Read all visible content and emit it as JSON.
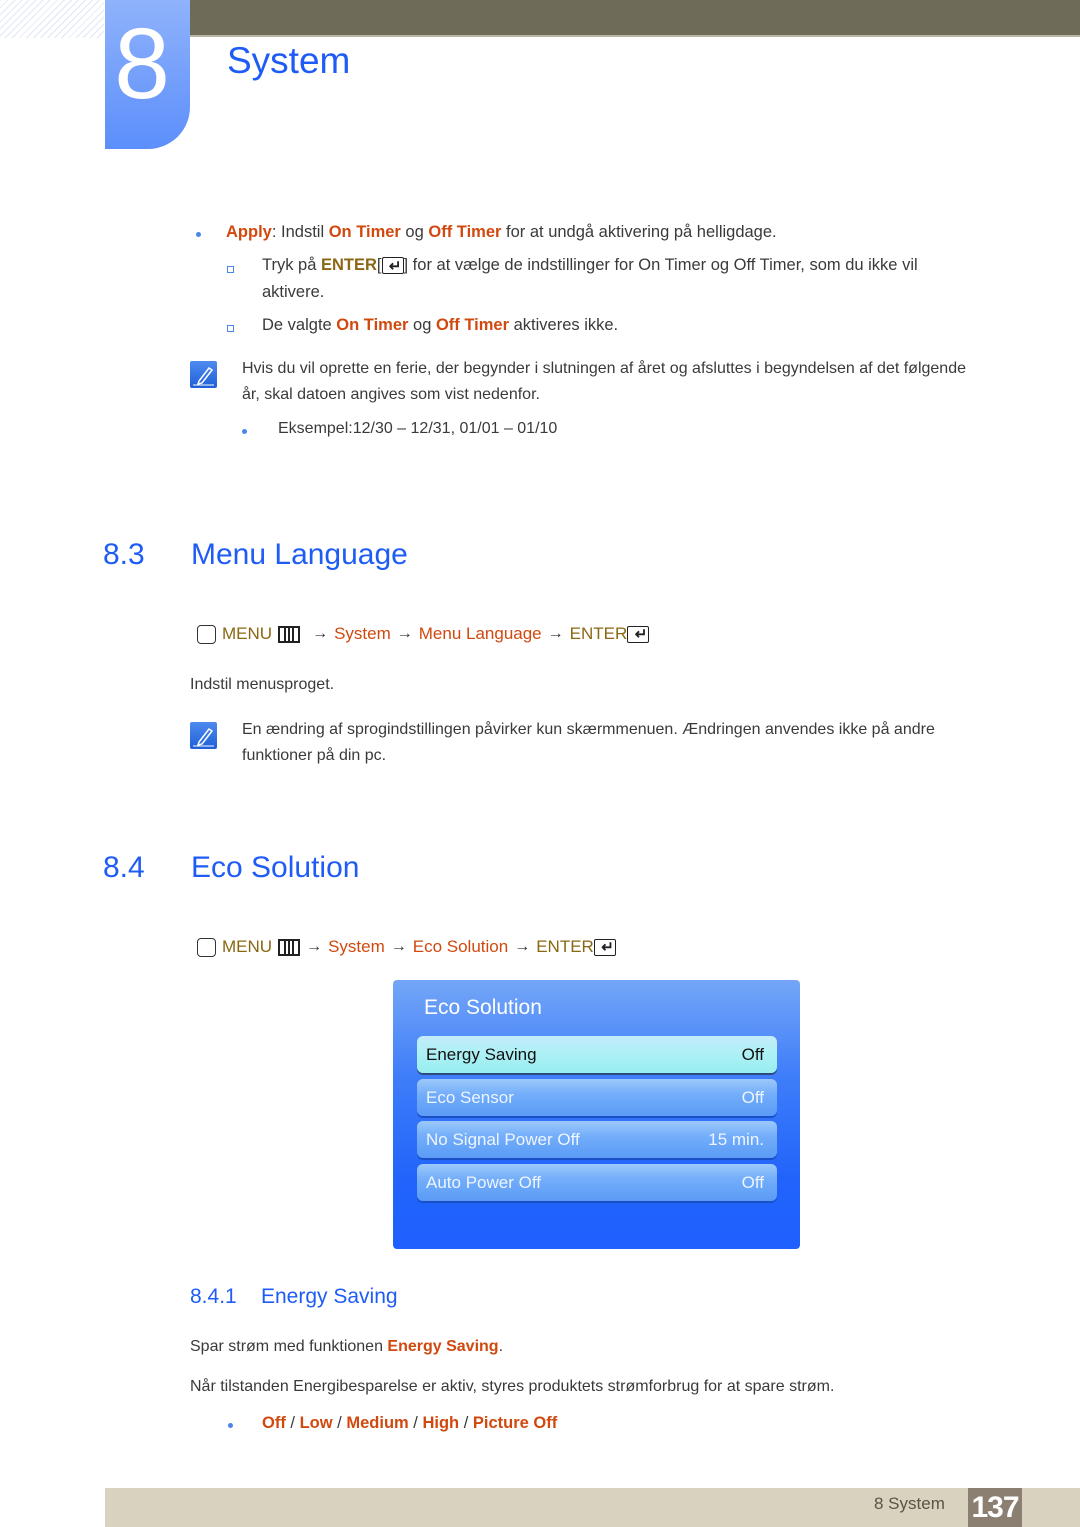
{
  "header": {
    "chapter_number": "8",
    "chapter_title": "System"
  },
  "apply_block": {
    "term": "Apply",
    "text_1": ": Indstil ",
    "on_timer": "On Timer",
    "og": " og ",
    "off_timer": "Off Timer",
    "text_2": " for at undgå aktivering på helligdage.",
    "sub_1_pre": "Tryk på ",
    "sub_1_enter": "ENTER",
    "sub_1_bracket_open": "[",
    "sub_1_bracket_close": "]",
    "sub_1_post": " for at vælge de indstillinger for On Timer og Off Timer, som du ikke vil",
    "sub_1_line2": "aktivere.",
    "sub_2_pre": "De valgte ",
    "sub_2_on": "On Timer",
    "sub_2_og": " og ",
    "sub_2_off": "Off Timer",
    "sub_2_post": " aktiveres ikke."
  },
  "note_1": {
    "line1": "Hvis du vil oprette en ferie, der begynder i slutningen af året og afsluttes i begyndelsen af det følgende",
    "line2": "år, skal datoen angives som vist nedenfor.",
    "example": "Eksempel:12/30 – 12/31, 01/01 – 01/10"
  },
  "section_8_3": {
    "number": "8.3",
    "title": "Menu Language",
    "path": {
      "menu": "MENU",
      "arrow": "→",
      "system": "System",
      "item": "Menu Language",
      "enter": "ENTER"
    },
    "description": "Indstil menusproget.",
    "note_line1": "En ændring af sprogindstillingen påvirker kun skærmmenuen. Ændringen anvendes ikke på andre",
    "note_line2": "funktioner på din pc."
  },
  "section_8_4": {
    "number": "8.4",
    "title": "Eco Solution",
    "path": {
      "menu": "MENU",
      "arrow": "→",
      "system": "System",
      "item": "Eco Solution",
      "enter": "ENTER"
    },
    "osd": {
      "title": "Eco Solution",
      "rows": [
        {
          "label": "Energy Saving",
          "value": "Off",
          "selected": true
        },
        {
          "label": "Eco Sensor",
          "value": "Off",
          "selected": false
        },
        {
          "label": "No Signal Power Off",
          "value": "15 min.",
          "selected": false
        },
        {
          "label": "Auto Power Off",
          "value": "Off",
          "selected": false
        }
      ]
    }
  },
  "section_8_4_1": {
    "number": "8.4.1",
    "title": "Energy Saving",
    "desc_pre": "Spar strøm med funktionen ",
    "desc_term": "Energy Saving",
    "desc_post": ".",
    "desc2": "Når tilstanden Energibesparelse er aktiv, styres produktets strømforbrug for at spare strøm.",
    "options": [
      "Off",
      "Low",
      "Medium",
      "High",
      "Picture Off"
    ],
    "separator": " / "
  },
  "footer": {
    "label": "8 System",
    "page": "137"
  }
}
